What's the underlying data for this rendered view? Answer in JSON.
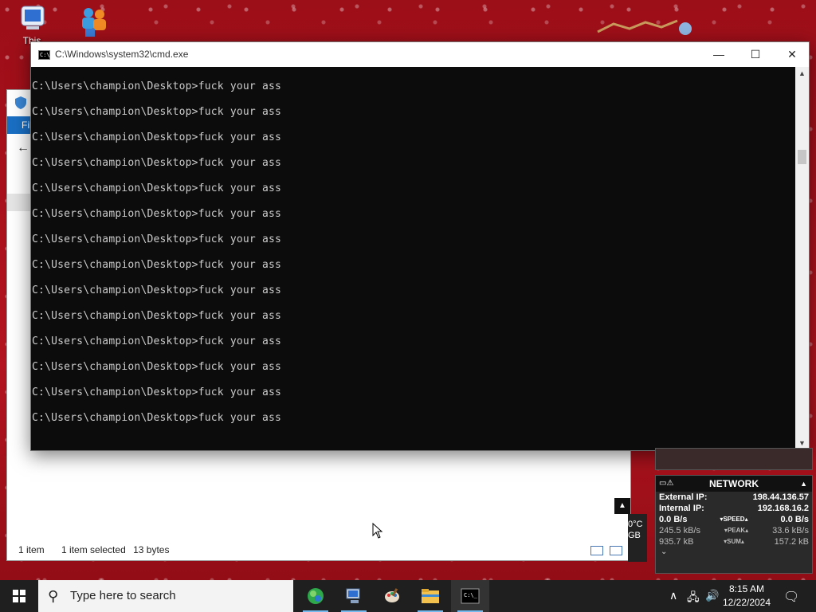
{
  "desktop": {
    "icons": [
      {
        "label": "This",
        "icon": "computer-icon"
      },
      {
        "label": "",
        "icon": "people-icon"
      }
    ]
  },
  "explorer": {
    "ribbon_tab": "Fil",
    "status_items": "1 item",
    "status_selected": "1 item selected",
    "status_size": "13 bytes",
    "side_text_1": "0°C",
    "side_text_2": "GB"
  },
  "cmd": {
    "title": "C:\\Windows\\system32\\cmd.exe",
    "icon_text": "C:\\",
    "lines": [
      "C:\\Users\\champion\\Desktop>fuck your ass",
      "C:\\Users\\champion\\Desktop>fuck your ass",
      "C:\\Users\\champion\\Desktop>fuck your ass",
      "C:\\Users\\champion\\Desktop>fuck your ass",
      "C:\\Users\\champion\\Desktop>fuck your ass",
      "C:\\Users\\champion\\Desktop>fuck your ass",
      "C:\\Users\\champion\\Desktop>fuck your ass",
      "C:\\Users\\champion\\Desktop>fuck your ass",
      "C:\\Users\\champion\\Desktop>fuck your ass",
      "C:\\Users\\champion\\Desktop>fuck your ass",
      "C:\\Users\\champion\\Desktop>fuck your ass",
      "C:\\Users\\champion\\Desktop>fuck your ass",
      "C:\\Users\\champion\\Desktop>fuck your ass",
      "C:\\Users\\champion\\Desktop>fuck your ass"
    ],
    "controls": {
      "minimize": "—",
      "maximize": "☐",
      "close": "✕"
    }
  },
  "network_gadget": {
    "title": "NETWORK",
    "external_ip_label": "External IP:",
    "external_ip": "198.44.136.57",
    "internal_ip_label": "Internal IP:",
    "internal_ip": "192.168.16.2",
    "speed_down": "0.0 B/s",
    "speed_label": "SPEED",
    "speed_up": "0.0 B/s",
    "peak_down": "245.5 kB/s",
    "peak_label": "PEAK",
    "peak_up": "33.6 kB/s",
    "sum_down": "935.7 kB",
    "sum_label": "SUM",
    "sum_up": "157.2 kB"
  },
  "taskbar": {
    "search_placeholder": "Type here to search",
    "time": "8:15 AM",
    "date": "12/22/2024",
    "apps": [
      "green-app-icon",
      "network-computer-icon",
      "paint-icon",
      "file-explorer-icon",
      "cmd-icon"
    ]
  },
  "colors": {
    "console_bg": "#0c0c0c",
    "console_fg": "#cccccc",
    "taskbar_bg": "#1f1f1f",
    "ribbon_blue": "#1a6fc4"
  }
}
